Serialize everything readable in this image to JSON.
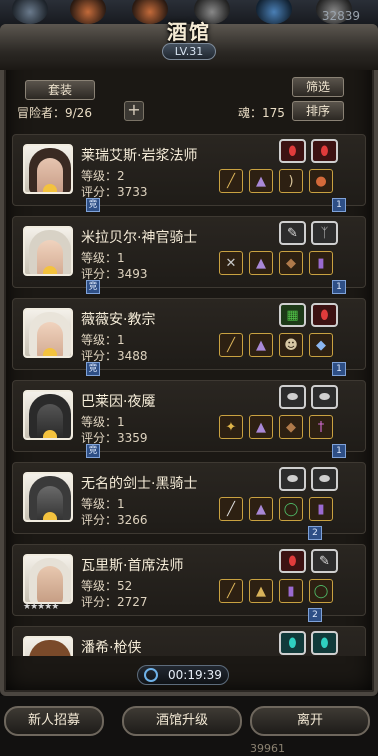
{
  "top": {
    "currency_value": "32839"
  },
  "header": {
    "title": "酒馆",
    "level": "LV.31"
  },
  "buttons": {
    "outfit": "套装",
    "filter": "筛选",
    "sort": "排序"
  },
  "stats": {
    "adventurers_label": "冒险者：9/26",
    "soul_label": "魂：175"
  },
  "heroes": [
    {
      "name": "莱瑞艾斯·岩浆法师",
      "level": "等级：2",
      "score": "评分：3733",
      "tag_left": "竞",
      "tag_right": "1",
      "top_icons": [
        "red-gem-icon",
        "red-gem-icon"
      ],
      "bottom_icons": [
        "staff-icon",
        "armor-icon",
        "bow-icon",
        "bag-icon"
      ]
    },
    {
      "name": "米拉贝尔·神官骑士",
      "level": "等级：1",
      "score": "评分：3493",
      "tag_left": "竞",
      "tag_right": "1",
      "top_icons": [
        "feather-icon",
        "wing-icon"
      ],
      "bottom_icons": [
        "hammer-icon",
        "armor-icon",
        "cloak-icon",
        "boots-icon"
      ]
    },
    {
      "name": "薇薇安·教宗",
      "level": "等级：1",
      "score": "评分：3488",
      "tag_left": "竞",
      "tag_right": "1",
      "top_icons": [
        "book-icon",
        "red-gem-icon"
      ],
      "bottom_icons": [
        "staff-icon",
        "armor-icon",
        "mask-icon",
        "crystal-icon"
      ]
    },
    {
      "name": "巴莱因·夜魇",
      "level": "等级：1",
      "score": "评分：3359",
      "tag_left": "竞",
      "tag_right": "1",
      "top_icons": [
        "stone-icon",
        "stone-icon"
      ],
      "bottom_icons": [
        "wand-icon",
        "armor-icon",
        "cloak-icon",
        "dagger-icon"
      ]
    },
    {
      "name": "无名的剑士·黑骑士",
      "level": "等级：1",
      "score": "评分：3266",
      "tag_left": "",
      "tag_right": "2",
      "top_icons": [
        "stone-icon",
        "stone-icon"
      ],
      "bottom_icons": [
        "sword-icon",
        "armor-icon",
        "ring-icon",
        "boots-icon"
      ]
    },
    {
      "name": "瓦里斯·首席法师",
      "level": "等级：52",
      "score": "评分：2727",
      "tag_left": "",
      "tag_right": "2",
      "stars": "★★★★★",
      "top_icons": [
        "red-gem-icon",
        "feather-icon"
      ],
      "bottom_icons": [
        "staff-icon",
        "armor-icon",
        "boots-icon",
        "ring-icon"
      ]
    },
    {
      "name": "潘希·枪侠",
      "level": "",
      "score": "",
      "tag_left": "",
      "tag_right": "",
      "top_icons": [
        "teal-gem-icon",
        "teal-gem-icon"
      ],
      "bottom_icons": []
    }
  ],
  "timer": "00:19:39",
  "bottom": {
    "recruit": "新人招募",
    "upgrade": "酒馆升级",
    "leave": "离开",
    "coins": "39961"
  },
  "colors": {
    "accent": "#c9a241",
    "tag_blue": "#2e4f86",
    "frame": "#4b4640"
  }
}
